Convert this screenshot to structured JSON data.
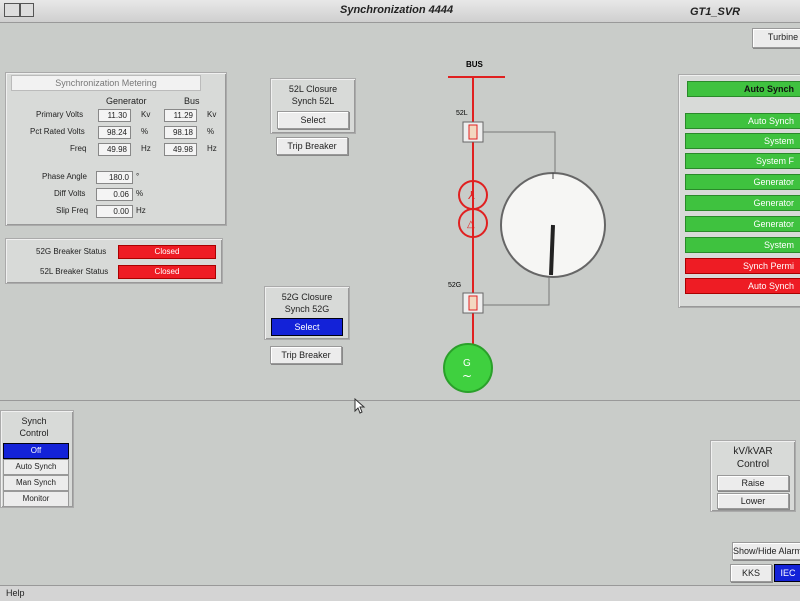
{
  "window": {
    "title": "Synchronization 4444",
    "right_label": "GT1_SVR",
    "help_label": "Help"
  },
  "turbine_button": "Turbine",
  "metering": {
    "title": "Synchronization Metering",
    "col_generator": "Generator",
    "col_bus": "Bus",
    "rows": [
      {
        "label": "Primary Volts",
        "gen": "11.30",
        "gen_unit": "Kv",
        "bus": "11.29",
        "bus_unit": "Kv"
      },
      {
        "label": "Pct Rated Volts",
        "gen": "98.24",
        "gen_unit": "%",
        "bus": "98.18",
        "bus_unit": "%"
      },
      {
        "label": "Freq",
        "gen": "49.98",
        "gen_unit": "Hz",
        "bus": "49.98",
        "bus_unit": "Hz"
      }
    ],
    "extra": [
      {
        "label": "Phase Angle",
        "value": "180.0",
        "unit": "°"
      },
      {
        "label": "Diff Volts",
        "value": "0.06",
        "unit": "%"
      },
      {
        "label": "Slip Freq",
        "value": "0.00",
        "unit": "Hz"
      }
    ]
  },
  "breaker_status": [
    {
      "label": "52G Breaker Status",
      "value": "Closed"
    },
    {
      "label": "52L Breaker Status",
      "value": "Closed"
    }
  ],
  "closure_52l": {
    "title_line1": "52L Closure",
    "title_line2": "Synch 52L",
    "select": "Select",
    "trip": "Trip Breaker"
  },
  "closure_52g": {
    "title_line1": "52G Closure",
    "title_line2": "Synch 52G",
    "select": "Select",
    "trip": "Trip Breaker"
  },
  "oneline": {
    "bus_label": "BUS",
    "breaker_top": "52L",
    "breaker_bottom": "52G",
    "generator": "G",
    "generator_symbol": "~"
  },
  "colors": {
    "line": "#e02020",
    "gen": "#3fd03f",
    "auto_green": "#3fc23f",
    "alarm_red": "#ee1c24",
    "select_blue": "#1322d8"
  },
  "auto_synch": {
    "title": "Auto Synch",
    "items": [
      {
        "label": "Auto Synch",
        "state": "green"
      },
      {
        "label": "System",
        "state": "green"
      },
      {
        "label": "System F",
        "state": "green"
      },
      {
        "label": "Generator",
        "state": "green"
      },
      {
        "label": "Generator",
        "state": "green"
      },
      {
        "label": "Generator",
        "state": "green"
      },
      {
        "label": "System",
        "state": "green"
      },
      {
        "label": "Synch Permi",
        "state": "red"
      },
      {
        "label": "Auto Synch",
        "state": "red"
      }
    ]
  },
  "synch_control": {
    "title_line1": "Synch",
    "title_line2": "Control",
    "options": [
      "Off",
      "Auto Synch",
      "Man Synch",
      "Monitor"
    ],
    "selected": "Off"
  },
  "kv_control": {
    "title_line1": "kV/kVAR",
    "title_line2": "Control",
    "raise": "Raise",
    "lower": "Lower"
  },
  "bottom_right": {
    "show_hide": "Show/Hide Alarm",
    "kks": "KKS",
    "iec": "IEC"
  }
}
